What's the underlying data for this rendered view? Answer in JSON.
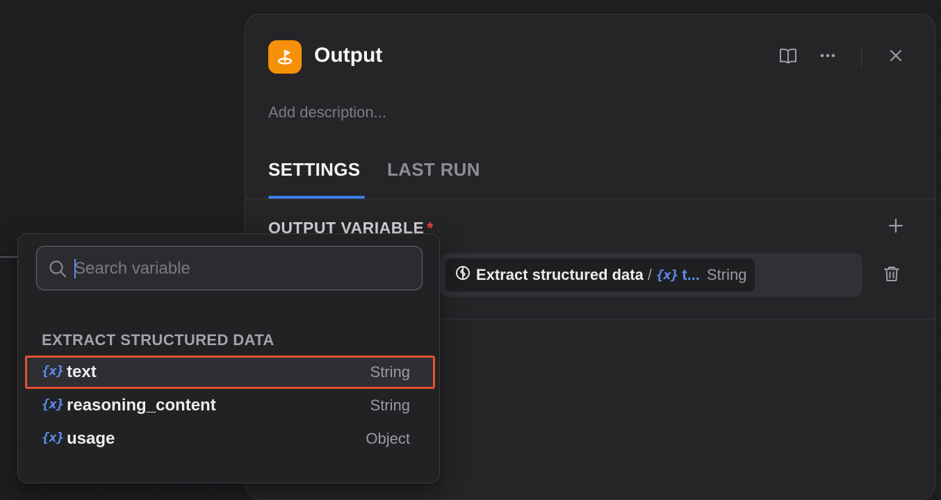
{
  "panel": {
    "title": "Output",
    "description_placeholder": "Add description...",
    "tabs": [
      {
        "label": "SETTINGS",
        "active": true
      },
      {
        "label": "LAST RUN",
        "active": false
      }
    ],
    "section": {
      "label": "OUTPUT VARIABLE",
      "required_mark": "*"
    },
    "variable": {
      "brace_icon": "{x}",
      "node_name": "Extract structured data",
      "separator": "/",
      "var_name": "t...",
      "type": "String"
    }
  },
  "picker": {
    "search_placeholder": "Search variable",
    "group_title": "EXTRACT STRUCTURED DATA",
    "brace_icon": "{x}",
    "options": [
      {
        "name": "text",
        "type": "String",
        "highlighted": true
      },
      {
        "name": "reasoning_content",
        "type": "String",
        "highlighted": false
      },
      {
        "name": "usage",
        "type": "Object",
        "highlighted": false
      }
    ]
  },
  "colors": {
    "accent": "#3d7eed",
    "node_icon_bg": "#f79009",
    "required": "#f04438",
    "variable": "#5b8def",
    "highlight_border": "#e2522f"
  },
  "icons": {
    "node": "output-node-icon",
    "docs": "book-icon",
    "more": "more-dots-icon",
    "close": "close-icon",
    "add": "plus-icon",
    "delete": "trash-icon",
    "search": "search-icon",
    "node_ref": "llm-node-icon"
  }
}
